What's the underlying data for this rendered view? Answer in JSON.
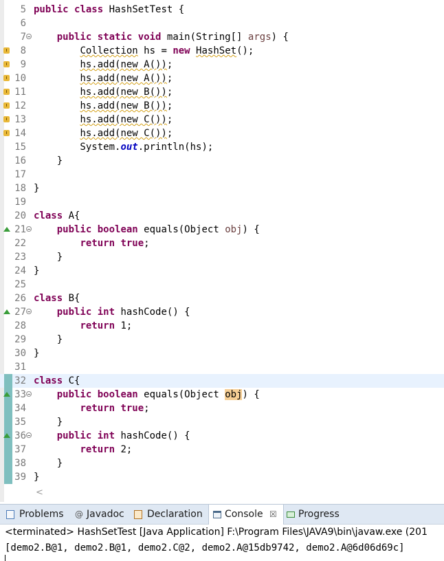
{
  "code_lines": [
    {
      "number": "5",
      "parts": [
        {
          "kw": "public"
        },
        {
          "t": " "
        },
        {
          "kw": "class"
        },
        {
          "t": " HashSetTest {"
        }
      ]
    },
    {
      "number": "6",
      "parts": []
    },
    {
      "number": "7",
      "fold": true,
      "parts": [
        {
          "t": "    "
        },
        {
          "kw": "public"
        },
        {
          "t": " "
        },
        {
          "kw": "static"
        },
        {
          "t": " "
        },
        {
          "kw": "void"
        },
        {
          "t": " main(String[] "
        },
        {
          "param": "args"
        },
        {
          "t": ") {"
        }
      ]
    },
    {
      "number": "8",
      "marker": "warning",
      "parts": [
        {
          "t": "        "
        },
        {
          "squig": "Collection"
        },
        {
          "t": " hs = "
        },
        {
          "kw": "new"
        },
        {
          "t": " "
        },
        {
          "squig": "HashSet"
        },
        {
          "t": "();"
        }
      ]
    },
    {
      "number": "9",
      "marker": "warning",
      "parts": [
        {
          "t": "        "
        },
        {
          "squig": "hs.add(new A())"
        },
        {
          "t": ";"
        }
      ]
    },
    {
      "number": "10",
      "marker": "warning",
      "parts": [
        {
          "t": "        "
        },
        {
          "squig": "hs.add(new A())"
        },
        {
          "t": ";"
        }
      ]
    },
    {
      "number": "11",
      "marker": "warning",
      "parts": [
        {
          "t": "        "
        },
        {
          "squig": "hs.add(new B())"
        },
        {
          "t": ";"
        }
      ]
    },
    {
      "number": "12",
      "marker": "warning",
      "parts": [
        {
          "t": "        "
        },
        {
          "squig": "hs.add(new B())"
        },
        {
          "t": ";"
        }
      ]
    },
    {
      "number": "13",
      "marker": "warning",
      "parts": [
        {
          "t": "        "
        },
        {
          "squig": "hs.add(new C())"
        },
        {
          "t": ";"
        }
      ]
    },
    {
      "number": "14",
      "marker": "warning",
      "parts": [
        {
          "t": "        "
        },
        {
          "squig": "hs.add(new C())"
        },
        {
          "t": ";"
        }
      ]
    },
    {
      "number": "15",
      "parts": [
        {
          "t": "        System."
        },
        {
          "field": "out"
        },
        {
          "t": ".println(hs);"
        }
      ]
    },
    {
      "number": "16",
      "parts": [
        {
          "t": "    }"
        }
      ]
    },
    {
      "number": "17",
      "parts": []
    },
    {
      "number": "18",
      "parts": [
        {
          "t": "}"
        }
      ]
    },
    {
      "number": "19",
      "parts": []
    },
    {
      "number": "20",
      "parts": [
        {
          "kw": "class"
        },
        {
          "t": " A{"
        }
      ]
    },
    {
      "number": "21",
      "fold": true,
      "marker": "override",
      "parts": [
        {
          "t": "    "
        },
        {
          "kw": "public"
        },
        {
          "t": " "
        },
        {
          "kw": "boolean"
        },
        {
          "t": " equals(Object "
        },
        {
          "param": "obj"
        },
        {
          "t": ") {"
        }
      ]
    },
    {
      "number": "22",
      "parts": [
        {
          "t": "        "
        },
        {
          "kw": "return"
        },
        {
          "t": " "
        },
        {
          "kw": "true"
        },
        {
          "t": ";"
        }
      ]
    },
    {
      "number": "23",
      "parts": [
        {
          "t": "    }"
        }
      ]
    },
    {
      "number": "24",
      "parts": [
        {
          "t": "}"
        }
      ]
    },
    {
      "number": "25",
      "parts": []
    },
    {
      "number": "26",
      "parts": [
        {
          "kw": "class"
        },
        {
          "t": " B{"
        }
      ]
    },
    {
      "number": "27",
      "fold": true,
      "marker": "override",
      "parts": [
        {
          "t": "    "
        },
        {
          "kw": "public"
        },
        {
          "t": " "
        },
        {
          "kw": "int"
        },
        {
          "t": " hashCode() {"
        }
      ]
    },
    {
      "number": "28",
      "parts": [
        {
          "t": "        "
        },
        {
          "kw": "return"
        },
        {
          "t": " 1;"
        }
      ]
    },
    {
      "number": "29",
      "parts": [
        {
          "t": "    }"
        }
      ]
    },
    {
      "number": "30",
      "parts": [
        {
          "t": "}"
        }
      ]
    },
    {
      "number": "31",
      "parts": []
    },
    {
      "number": "32",
      "changed": true,
      "current": true,
      "parts": [
        {
          "kw": "class"
        },
        {
          "t": " C{"
        }
      ]
    },
    {
      "number": "33",
      "changed": true,
      "fold": true,
      "marker": "override",
      "parts": [
        {
          "t": "    "
        },
        {
          "kw": "public"
        },
        {
          "t": " "
        },
        {
          "kw": "boolean"
        },
        {
          "t": " equals(Object "
        },
        {
          "hl": "obj"
        },
        {
          "t": ") {"
        }
      ]
    },
    {
      "number": "34",
      "changed": true,
      "parts": [
        {
          "t": "        "
        },
        {
          "kw": "return"
        },
        {
          "t": " "
        },
        {
          "kw": "true"
        },
        {
          "t": ";"
        }
      ]
    },
    {
      "number": "35",
      "changed": true,
      "parts": [
        {
          "t": "    }"
        }
      ]
    },
    {
      "number": "36",
      "changed": true,
      "fold": true,
      "marker": "override",
      "parts": [
        {
          "t": "    "
        },
        {
          "kw": "public"
        },
        {
          "t": " "
        },
        {
          "kw": "int"
        },
        {
          "t": " hashCode() {"
        }
      ]
    },
    {
      "number": "37",
      "changed": true,
      "parts": [
        {
          "t": "        "
        },
        {
          "kw": "return"
        },
        {
          "t": " 2;"
        }
      ]
    },
    {
      "number": "38",
      "changed": true,
      "parts": [
        {
          "t": "    }"
        }
      ]
    },
    {
      "number": "39",
      "changed": true,
      "parts": [
        {
          "t": "}"
        }
      ]
    }
  ],
  "editor": {
    "scroll_left_arrow": "<"
  },
  "tabs": [
    {
      "name": "problems",
      "label": "Problems",
      "icon": "problems-icon",
      "active": false
    },
    {
      "name": "javadoc",
      "label": "Javadoc",
      "icon": "javadoc-at-icon",
      "active": false
    },
    {
      "name": "declaration",
      "label": "Declaration",
      "icon": "declaration-icon",
      "active": false
    },
    {
      "name": "console",
      "label": "Console",
      "icon": "console-icon",
      "active": true,
      "close": "☒"
    },
    {
      "name": "progress",
      "label": "Progress",
      "icon": "progress-icon",
      "active": false
    }
  ],
  "console": {
    "status": "<terminated> HashSetTest [Java Application] F:\\Program Files\\JAVA9\\bin\\javaw.exe (201",
    "output": "[demo2.B@1, demo2.B@1, demo2.C@2, demo2.A@15db9742, demo2.A@6d06d69c]"
  },
  "colors": {
    "keyword": "#7f0055",
    "field": "#0000c0",
    "parameter": "#6a3e3e",
    "warning": "#e9b838",
    "override": "#3a9d3a",
    "change": "#7fbfbf"
  }
}
